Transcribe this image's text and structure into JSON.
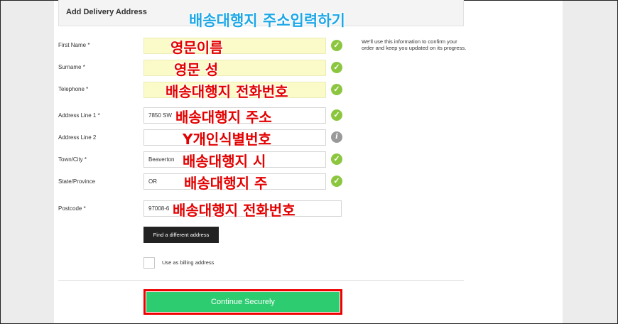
{
  "form": {
    "header_title": "Add Delivery Address",
    "help_text": "We'll use this information to confirm your order and keep you updated on its progress.",
    "fields": [
      {
        "label": "First Name",
        "required": "*",
        "value": "",
        "status": "valid"
      },
      {
        "label": "Surname",
        "required": "*",
        "value": "",
        "status": "valid"
      },
      {
        "label": "Telephone",
        "required": "*",
        "value": "",
        "status": "valid"
      },
      {
        "label": "Address Line 1",
        "required": "*",
        "value": "7850 SW",
        "status": "valid"
      },
      {
        "label": "Address Line 2",
        "required": "",
        "value": "",
        "status": "info"
      },
      {
        "label": "Town/City",
        "required": "*",
        "value": "Beaverton",
        "status": "valid"
      },
      {
        "label": "State/Province",
        "required": "",
        "value": "OR",
        "status": "valid"
      },
      {
        "label": "Postcode",
        "required": "*",
        "value": "97008-6",
        "status": ""
      }
    ],
    "find_address_label": "Find a different address",
    "billing_checkbox_label": "Use as billing address",
    "billing_checked": false,
    "continue_label": "Continue Securely"
  },
  "annotations": {
    "title": "배송대행지 주소입력하기",
    "first_name": "영문이름",
    "surname": "영문 성",
    "telephone": "배송대행지 전화번호",
    "address1": "배송대행지 주소",
    "address2": "Y개인식별번호",
    "city": "배송대행지 시",
    "state": "배송대행지 주",
    "postcode": "배송대행지 전화번호"
  },
  "icons": {
    "valid": "check-circle-icon",
    "info": "info-circle-icon"
  },
  "colors": {
    "valid": "#8cc63f",
    "cta": "#2ecc71",
    "highlight": "#fbfbc9",
    "annotation_red": "#e30000",
    "annotation_blue": "#1ea7e6"
  }
}
